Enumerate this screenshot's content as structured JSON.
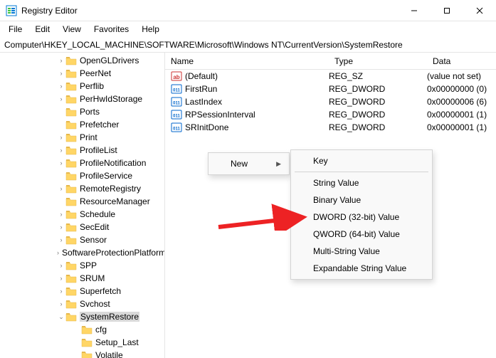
{
  "window": {
    "title": "Registry Editor"
  },
  "menubar": [
    "File",
    "Edit",
    "View",
    "Favorites",
    "Help"
  ],
  "address": "Computer\\HKEY_LOCAL_MACHINE\\SOFTWARE\\Microsoft\\Windows NT\\CurrentVersion\\SystemRestore",
  "tree": [
    {
      "label": "OpenGLDrivers",
      "expandable": true
    },
    {
      "label": "PeerNet",
      "expandable": true
    },
    {
      "label": "Perflib",
      "expandable": true
    },
    {
      "label": "PerHwIdStorage",
      "expandable": true
    },
    {
      "label": "Ports",
      "expandable": false
    },
    {
      "label": "Prefetcher",
      "expandable": false
    },
    {
      "label": "Print",
      "expandable": true
    },
    {
      "label": "ProfileList",
      "expandable": true
    },
    {
      "label": "ProfileNotification",
      "expandable": true
    },
    {
      "label": "ProfileService",
      "expandable": false
    },
    {
      "label": "RemoteRegistry",
      "expandable": true
    },
    {
      "label": "ResourceManager",
      "expandable": false
    },
    {
      "label": "Schedule",
      "expandable": true
    },
    {
      "label": "SecEdit",
      "expandable": true
    },
    {
      "label": "Sensor",
      "expandable": true
    },
    {
      "label": "SoftwareProtectionPlatform",
      "expandable": true
    },
    {
      "label": "SPP",
      "expandable": true
    },
    {
      "label": "SRUM",
      "expandable": true
    },
    {
      "label": "Superfetch",
      "expandable": true
    },
    {
      "label": "Svchost",
      "expandable": true
    },
    {
      "label": "SystemRestore",
      "expandable": true,
      "expanded": true,
      "selected": true
    }
  ],
  "tree_children": [
    {
      "label": "cfg"
    },
    {
      "label": "Setup_Last"
    },
    {
      "label": "Volatile"
    }
  ],
  "list_headers": {
    "name": "Name",
    "type": "Type",
    "data": "Data"
  },
  "list_rows": [
    {
      "name": "(Default)",
      "type": "REG_SZ",
      "data": "(value not set)",
      "kind": "string"
    },
    {
      "name": "FirstRun",
      "type": "REG_DWORD",
      "data": "0x00000000 (0)",
      "kind": "binary"
    },
    {
      "name": "LastIndex",
      "type": "REG_DWORD",
      "data": "0x00000006 (6)",
      "kind": "binary"
    },
    {
      "name": "RPSessionInterval",
      "type": "REG_DWORD",
      "data": "0x00000001 (1)",
      "kind": "binary"
    },
    {
      "name": "SRInitDone",
      "type": "REG_DWORD",
      "data": "0x00000001 (1)",
      "kind": "binary"
    }
  ],
  "context_menu": {
    "label": "New"
  },
  "submenu": [
    {
      "label": "Key",
      "kind": "item"
    },
    {
      "kind": "divider"
    },
    {
      "label": "String Value",
      "kind": "item"
    },
    {
      "label": "Binary Value",
      "kind": "item"
    },
    {
      "label": "DWORD (32-bit) Value",
      "kind": "item"
    },
    {
      "label": "QWORD (64-bit) Value",
      "kind": "item"
    },
    {
      "label": "Multi-String Value",
      "kind": "item"
    },
    {
      "label": "Expandable String Value",
      "kind": "item"
    }
  ],
  "colors": {
    "accent": "#0078d4",
    "folder": "#ffd666",
    "folder_tab": "#e6b84d",
    "arrow_red": "#ed2224"
  }
}
